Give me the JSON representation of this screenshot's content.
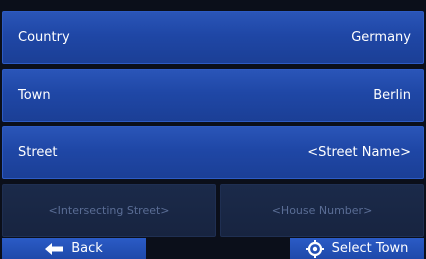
{
  "rows": [
    {
      "label": "Country",
      "value": "Germany"
    },
    {
      "label": "Town",
      "value": "Berlin"
    },
    {
      "label": "Street",
      "value": "<Street Name>"
    }
  ],
  "intersecting_placeholder": "<Intersecting Street>",
  "house_number_placeholder": "<House Number>",
  "buttons": {
    "back_label": "Back",
    "select_town_label": "Select Town"
  },
  "icons": {
    "back": "arrow-left-icon",
    "select": "crosshair-target-icon"
  },
  "colors": {
    "row_blue": "#1f47a6",
    "disabled_text": "#5a6d95",
    "background": "#0b0f1a"
  }
}
